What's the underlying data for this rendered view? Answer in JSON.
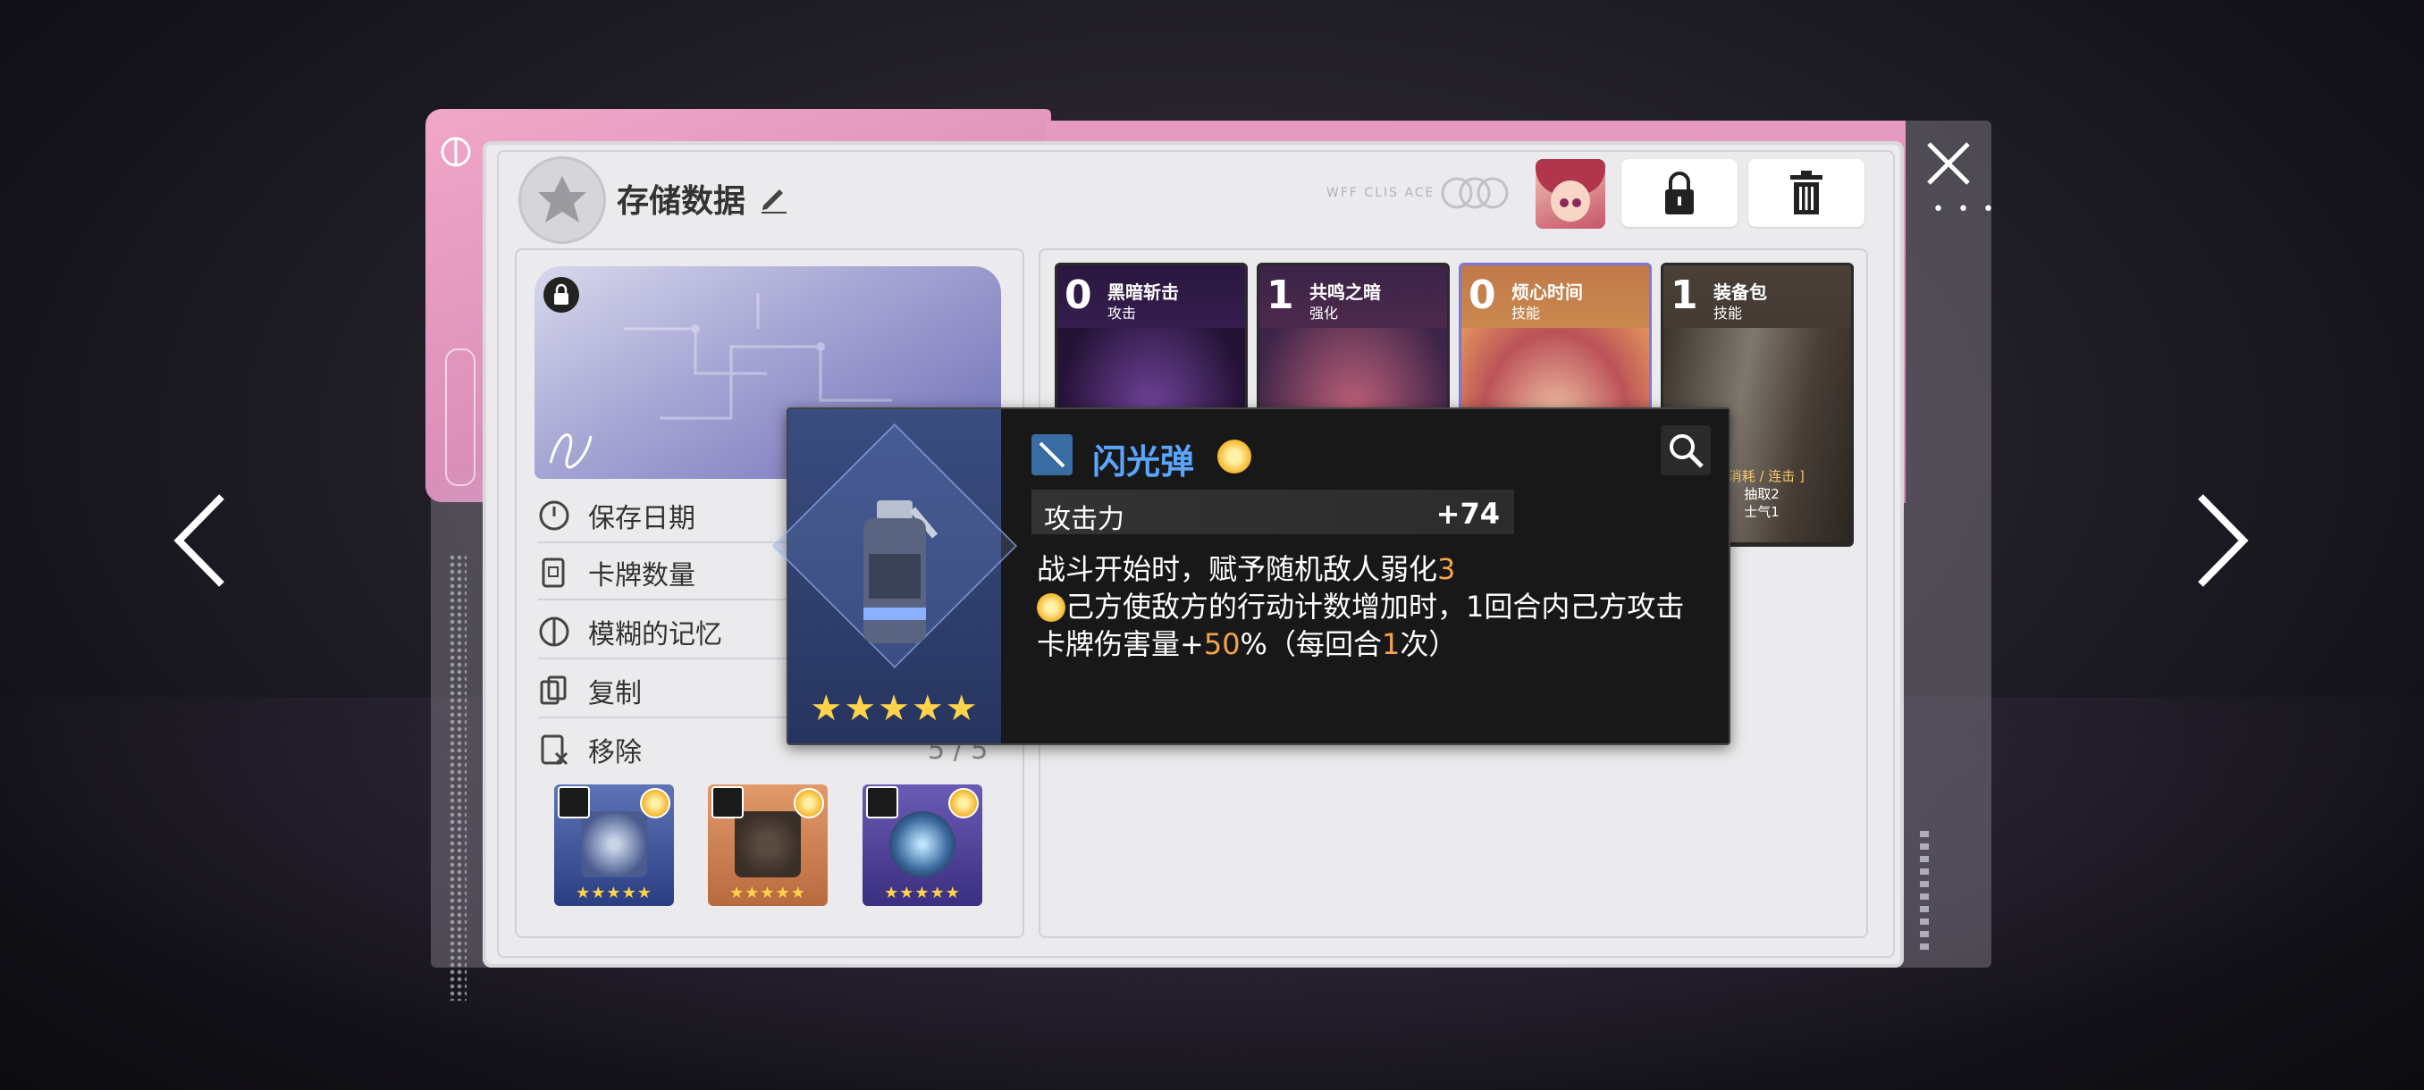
{
  "header": {
    "title": "存储数据",
    "faint_caption": "WFF CLIS ACE"
  },
  "info_rows": [
    {
      "label": "保存日期",
      "icon": "clock-icon"
    },
    {
      "label": "卡牌数量",
      "icon": "card-count-icon"
    },
    {
      "label": "模糊的记忆",
      "icon": "brain-icon"
    },
    {
      "label": "复制",
      "icon": "copy-icon"
    },
    {
      "label": "移除",
      "icon": "remove-icon"
    }
  ],
  "equipment_count": "5 / 5",
  "equipment": [
    {
      "slot": "weapon",
      "stars": "★★★★★"
    },
    {
      "slot": "armor",
      "stars": "★★★★★"
    },
    {
      "slot": "ring",
      "stars": "★★★★★"
    }
  ],
  "cards": [
    {
      "cost": "0",
      "name": "黑暗斩击",
      "type": "攻击"
    },
    {
      "cost": "1",
      "name": "共鸣之暗",
      "type": "强化"
    },
    {
      "cost": "0",
      "name": "烦心时间",
      "type": "技能"
    },
    {
      "cost": "1",
      "name": "装备包",
      "type": "技能",
      "desc_1": "[ 消耗 / 连击 ]",
      "desc_2": "抽取2",
      "desc_3": "士气1"
    }
  ],
  "tooltip": {
    "title": "闪光弹",
    "stat_name": "攻击力",
    "stat_value": "+74",
    "desc_line1_pre": "战斗开始时，赋予随机敌人弱化",
    "desc_line1_val": "3",
    "desc_line2_pre": "己方使敌方的行动计数增加时，1回合内己方攻击卡牌伤害量+",
    "desc_line2_val": "50",
    "desc_line2_mid": "%（每回合",
    "desc_line2_val2": "1",
    "desc_line2_post": "次）",
    "stars": "★★★★★"
  },
  "colors": {
    "accent_blue": "#5aa6ff",
    "highlight_orange": "#f5a54a",
    "star_gold": "#ffd34a",
    "panel_bg": "#ebebed",
    "pink_tab": "#e69ac0"
  }
}
